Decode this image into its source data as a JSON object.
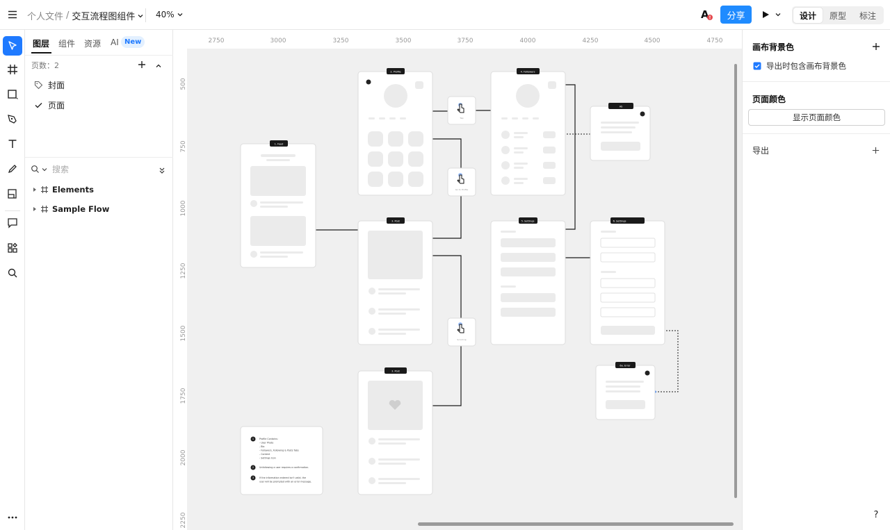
{
  "header": {
    "breadcrumb_root": "个人文件",
    "breadcrumb_sep": "/",
    "file_name": "交互流程图组件",
    "zoom": "40%",
    "share_label": "分享",
    "modes": [
      "设计",
      "原型",
      "标注"
    ],
    "active_mode": "设计"
  },
  "left_panel": {
    "tabs": [
      "图层",
      "组件",
      "资源",
      "AI"
    ],
    "ai_badge": "New",
    "page_count": "页数：2",
    "pages": [
      "封面",
      "页面"
    ],
    "search_placeholder": "搜索",
    "layers": [
      "Elements",
      "Sample Flow"
    ]
  },
  "right_panel": {
    "canvas_bg_title": "画布背景色",
    "include_bg_label": "导出时包含画布背景色",
    "include_bg_checked": true,
    "page_color_title": "页面颜色",
    "show_page_color_button": "显示页面颜色",
    "export_title": "导出"
  },
  "ruler": {
    "x_ticks": [
      "2750",
      "3000",
      "3250",
      "3500",
      "3750",
      "4000",
      "4250",
      "4500",
      "4750"
    ],
    "y_ticks": [
      "500",
      "750",
      "1000",
      "1250",
      "1500",
      "1750",
      "2000",
      "2250"
    ]
  },
  "flow_frames": {
    "feed": "1. Feed",
    "profile": "2. Profile",
    "post": "3. Post",
    "post2": "3. Post",
    "followers": "4. Followers",
    "settings": "5. Settings",
    "settings2": "6. Settings",
    "ab": "Ab",
    "error": "6a. Error"
  },
  "tap_labels": [
    "Tap",
    "Go to Profile",
    "Scroll Up"
  ],
  "notes": [
    {
      "num": "1",
      "lines": [
        "Profile Contains:",
        "- User Photo",
        "- Bio",
        "- Followers, Following & Posts Tabs",
        "- Content",
        "- Settings Icon"
      ]
    },
    {
      "num": "2",
      "lines": [
        "Unfollowing a user requires a confirmation."
      ]
    },
    {
      "num": "3",
      "lines": [
        "If the information entered isn't valid, the",
        "user will be prompted with an error message."
      ]
    }
  ],
  "colors": {
    "accent": "#1f7aff",
    "share": "#1f8bff",
    "canvas": "#f0f0f0"
  },
  "help_label": "?"
}
